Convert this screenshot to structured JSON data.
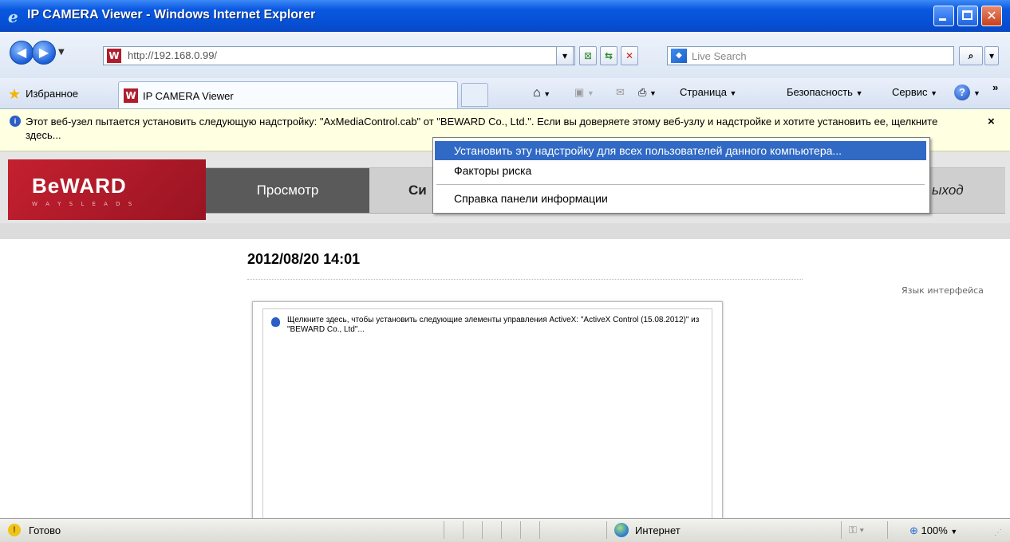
{
  "window": {
    "title": "IP CAMERA Viewer - Windows Internet Explorer",
    "ie_glyph": "e"
  },
  "address_bar": {
    "url": "http://192.168.0.99/",
    "search_placeholder": "Live Search"
  },
  "favorites": {
    "label": "Избранное",
    "tab_title": "IP CAMERA Viewer"
  },
  "command_bar": {
    "page": "Страница",
    "safety": "Безопасность",
    "tools": "Сервис",
    "overflow": "»"
  },
  "info_bar": {
    "message": "Этот веб-узел пытается установить следующую надстройку: \"AxMediaControl.cab\" от \"BEWARD Co., Ltd.\". Если вы доверяете этому веб-узлу и надстройке и хотите установить ее, щелкните здесь...",
    "close": "×"
  },
  "context_menu": {
    "items": [
      "Установить эту надстройку для всех пользователей данного компьютера...",
      "Факторы риска",
      "Справка панели информации"
    ]
  },
  "site": {
    "logo": "BeWARD",
    "logo_tagline": "W A Y S    L E A D S",
    "menu": {
      "view": "Просмотр",
      "system": "Си",
      "exit": "ыход"
    },
    "datetime": "2012/08/20 14:01",
    "language_label": "Язык интерфейса",
    "activex_message": "Щелкните здесь, чтобы установить следующие элементы управления ActiveX: \"ActiveX Control (15.08.2012)\" из \"BEWARD Co., Ltd\"..."
  },
  "status_bar": {
    "status": "Готово",
    "zone": "Интернет",
    "zoom": "100%"
  },
  "colors": {
    "title_bar": "#0550d6",
    "brand_red": "#c42030",
    "info_bar": "#ffffe1",
    "menu_highlight": "#316ac5",
    "active_nav": "#5a5a5a"
  },
  "icons": [
    "ie-logo-icon",
    "back-icon",
    "forward-icon",
    "home-icon",
    "rss-icon",
    "mail-icon",
    "print-icon",
    "help-icon",
    "shield-icon",
    "star-icon",
    "globe-icon",
    "lock-icon",
    "zoom-icon"
  ]
}
